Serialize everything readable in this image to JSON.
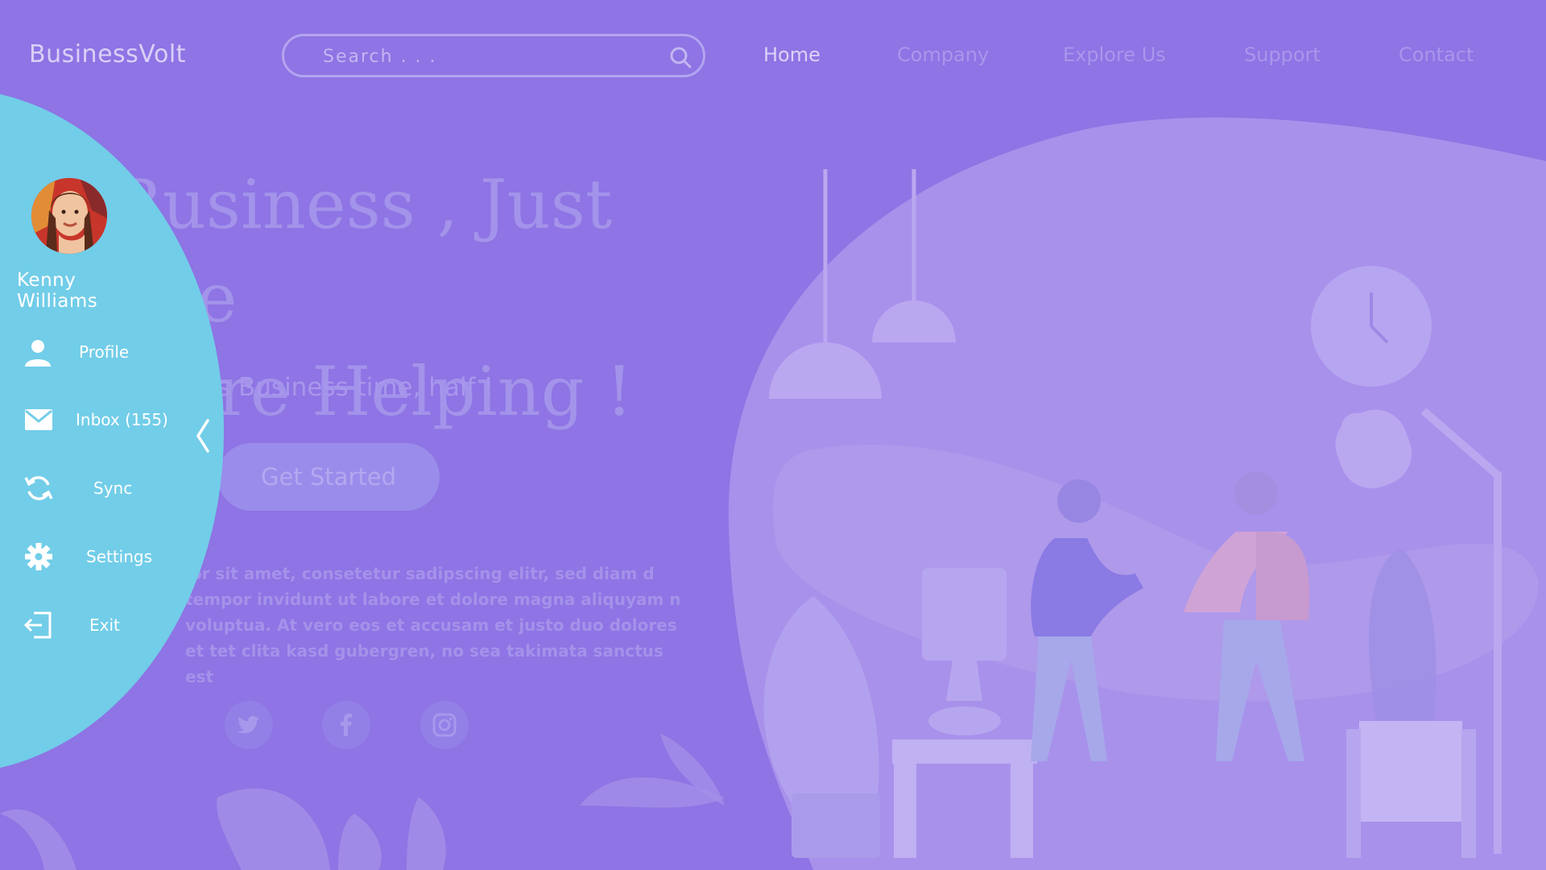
{
  "brand": {
    "name": "BusinessVolt"
  },
  "search": {
    "placeholder": "Search . . .",
    "icon": "search-icon"
  },
  "nav": {
    "items": [
      {
        "label": "Home",
        "active": true
      },
      {
        "label": "Company",
        "active": false
      },
      {
        "label": "Explore Us",
        "active": false
      },
      {
        "label": "Support",
        "active": false
      },
      {
        "label": "Contact",
        "active": false
      }
    ]
  },
  "hero": {
    "headline_line1": "Business , Just one",
    "headline_line2": "ore Helping !",
    "subline": "s Business time, half !",
    "cta_label": "Get Started",
    "paragraph": "lor sit amet, consetetur sadipscing elitr, sed diam d tempor invidunt ut labore et dolore magna aliquyam n voluptua. At vero eos et accusam et justo duo dolores et tet clita kasd gubergren, no sea takimata sanctus est",
    "social": [
      "twitter-icon",
      "facebook-icon",
      "instagram-icon"
    ]
  },
  "drawer": {
    "user_name": "Kenny Williams",
    "menu": [
      {
        "label": "Profile",
        "icon": "user-icon"
      },
      {
        "label": "Inbox (155)",
        "icon": "mail-icon"
      },
      {
        "label": "Sync",
        "icon": "sync-icon"
      },
      {
        "label": "Settings",
        "icon": "gear-icon"
      },
      {
        "label": "Exit",
        "icon": "exit-icon"
      }
    ],
    "collapse_icon": "chevron-left-icon"
  },
  "colors": {
    "background": "#8e74e4",
    "drawer": "#72cde8",
    "blob": "#a891eb",
    "text_light": "#ffffff"
  }
}
